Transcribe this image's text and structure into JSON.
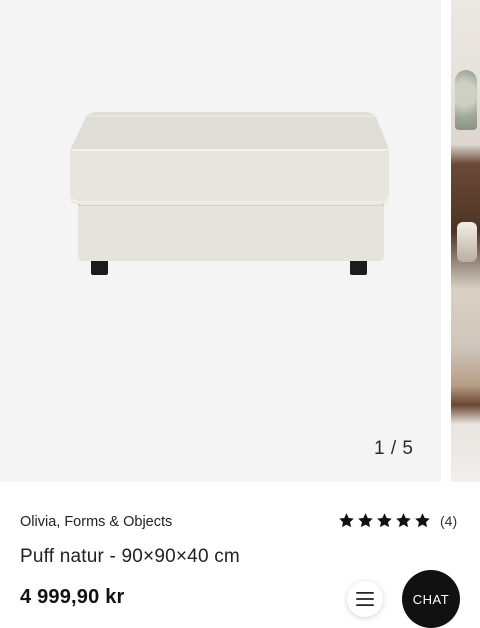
{
  "gallery": {
    "counter": "1 / 5",
    "current_slide": 1,
    "total_slides": 5,
    "main_image": "ottoman-product-photo",
    "next_image": "living-room-photo"
  },
  "product": {
    "brand": "Olivia, Forms & Objects",
    "title": "Puff natur - 90×90×40 cm",
    "price": "4 999,90 kr",
    "rating": {
      "stars": 5,
      "max_stars": 5,
      "count_label": "(4)"
    }
  },
  "actions": {
    "menu_icon": "hamburger-menu-icon",
    "chat_label": "CHAT"
  },
  "colors": {
    "background": "#ffffff",
    "image_bg": "#f4f4f5",
    "chat_button": "#111111",
    "text": "#1a1a1a"
  }
}
